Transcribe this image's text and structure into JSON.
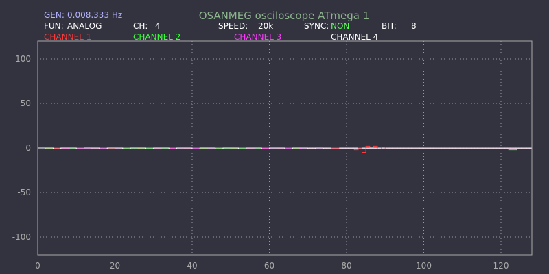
{
  "header": {
    "gen_label": "GEN:",
    "gen_value": "0.008.333 Hz",
    "title": "OSANMEG osciloscope ATmega 1",
    "fun_label": "FUN:",
    "fun_value": "ANALOG",
    "ch_label": "CH:",
    "ch_value": "4",
    "speed_label": "SPEED:",
    "speed_value": "20k",
    "sync_label": "SYNC:",
    "sync_value": "NON",
    "bit_label": "BIT:",
    "bit_value": "8"
  },
  "colors": {
    "background": "#33333f",
    "plot_border": "#aaaaaa",
    "grid": "#9a9aa6",
    "text": "#ffffff",
    "gen": "#b4b4ff",
    "title": "#8cb48c",
    "sync_value": "#5aff5a"
  },
  "chart_data": {
    "type": "line",
    "x_ticks": [
      0,
      20,
      40,
      60,
      80,
      100,
      120
    ],
    "y_ticks": [
      100,
      50,
      0,
      -50,
      -100
    ],
    "xlim": [
      0,
      128
    ],
    "ylim": [
      -120,
      120
    ],
    "grid": true,
    "series": [
      {
        "name": "CHANNEL 1",
        "color": "#ff3a3a",
        "x": [
          0,
          2,
          4,
          6,
          8,
          10,
          12,
          14,
          16,
          18,
          20,
          22,
          24,
          26,
          28,
          30,
          32,
          34,
          36,
          38,
          40,
          42,
          44,
          46,
          48,
          50,
          52,
          54,
          56,
          58,
          60,
          62,
          64,
          66,
          68,
          70,
          72,
          74,
          76,
          78,
          80,
          82,
          83,
          84,
          85,
          86,
          87,
          88,
          89,
          90,
          92,
          94,
          96,
          98,
          100,
          102,
          104,
          106,
          108,
          110,
          112,
          114,
          116,
          118,
          120,
          122,
          124,
          126,
          128
        ],
        "values": [
          0,
          -1,
          0,
          -1,
          0,
          -1,
          0,
          -1,
          0,
          -1,
          0,
          -1,
          0,
          -1,
          0,
          -1,
          0,
          -1,
          0,
          -1,
          0,
          -1,
          0,
          -1,
          0,
          -1,
          0,
          -1,
          0,
          -1,
          0,
          -1,
          0,
          -1,
          0,
          -1,
          0,
          -1,
          0,
          -1,
          -1,
          -2,
          0,
          -5,
          2,
          1,
          2,
          -1,
          1,
          -1,
          -1,
          -1,
          -1,
          -1,
          -1,
          -1,
          -1,
          -1,
          -1,
          -1,
          -1,
          -1,
          -1,
          -1,
          -1,
          -1,
          -1,
          -1,
          -1
        ]
      },
      {
        "name": "CHANNEL 2",
        "color": "#3aff3a",
        "x": [
          0,
          2,
          4,
          6,
          8,
          10,
          12,
          14,
          16,
          18,
          20,
          22,
          24,
          26,
          28,
          30,
          32,
          34,
          36,
          38,
          40,
          42,
          44,
          46,
          48,
          50,
          52,
          54,
          56,
          58,
          60,
          62,
          64,
          66,
          68,
          70,
          72,
          74,
          76,
          78,
          80,
          82,
          84,
          86,
          88,
          90,
          92,
          94,
          96,
          98,
          100,
          102,
          104,
          106,
          108,
          110,
          112,
          114,
          116,
          118,
          120,
          122,
          124,
          126,
          128
        ],
        "values": [
          0,
          -1,
          -1,
          0,
          -1,
          -1,
          0,
          -1,
          -1,
          0,
          -1,
          0,
          -1,
          -1,
          0,
          -1,
          -1,
          0,
          -1,
          -1,
          0,
          -1,
          -1,
          0,
          -1,
          -1,
          0,
          -1,
          -1,
          0,
          -1,
          -1,
          0,
          -1,
          -1,
          -1,
          -1,
          -1,
          -1,
          -1,
          -1,
          -1,
          -1,
          -1,
          -1,
          -1,
          -1,
          -1,
          -1,
          -1,
          -1,
          -1,
          -1,
          -1,
          -1,
          -1,
          -1,
          -1,
          -1,
          -1,
          -1,
          -2,
          -1,
          -1,
          -1
        ]
      },
      {
        "name": "CHANNEL 3",
        "color": "#ff3aff",
        "x": [
          0,
          4,
          8,
          12,
          16,
          20,
          24,
          28,
          32,
          36,
          40,
          44,
          48,
          52,
          56,
          60,
          64,
          68,
          72,
          76,
          80,
          84,
          88,
          92,
          96,
          100,
          104,
          108,
          112,
          116,
          120,
          124,
          128
        ],
        "values": [
          0,
          -1,
          0,
          -1,
          0,
          -1,
          0,
          -1,
          0,
          -1,
          0,
          -1,
          0,
          -1,
          0,
          -1,
          0,
          -1,
          -1,
          -1,
          -1,
          -1,
          -1,
          -1,
          -1,
          -1,
          -1,
          -1,
          -1,
          -1,
          -1,
          -1,
          -1
        ]
      },
      {
        "name": "CHANNEL 4",
        "color": "#ffffff",
        "x": [
          0,
          2,
          4,
          6,
          8,
          10,
          12,
          14,
          16,
          18,
          20,
          22,
          24,
          26,
          28,
          30,
          32,
          34,
          36,
          38,
          40,
          42,
          44,
          46,
          48,
          50,
          52,
          54,
          56,
          58,
          60,
          62,
          64,
          66,
          68,
          70,
          72,
          74,
          76,
          78,
          80,
          84,
          88,
          92,
          96,
          100,
          104,
          108,
          112,
          116,
          120,
          124,
          128
        ],
        "values": [
          0,
          0,
          -1,
          0,
          0,
          -1,
          0,
          0,
          -1,
          0,
          0,
          -1,
          0,
          0,
          -1,
          0,
          0,
          -1,
          0,
          0,
          -1,
          0,
          0,
          -1,
          0,
          0,
          -1,
          0,
          0,
          -1,
          0,
          0,
          -1,
          0,
          0,
          -1,
          0,
          -1,
          -1,
          -1,
          -1,
          -1,
          -1,
          -1,
          -1,
          -1,
          -1,
          -1,
          -1,
          -1,
          -1,
          -1,
          -1
        ]
      }
    ]
  }
}
